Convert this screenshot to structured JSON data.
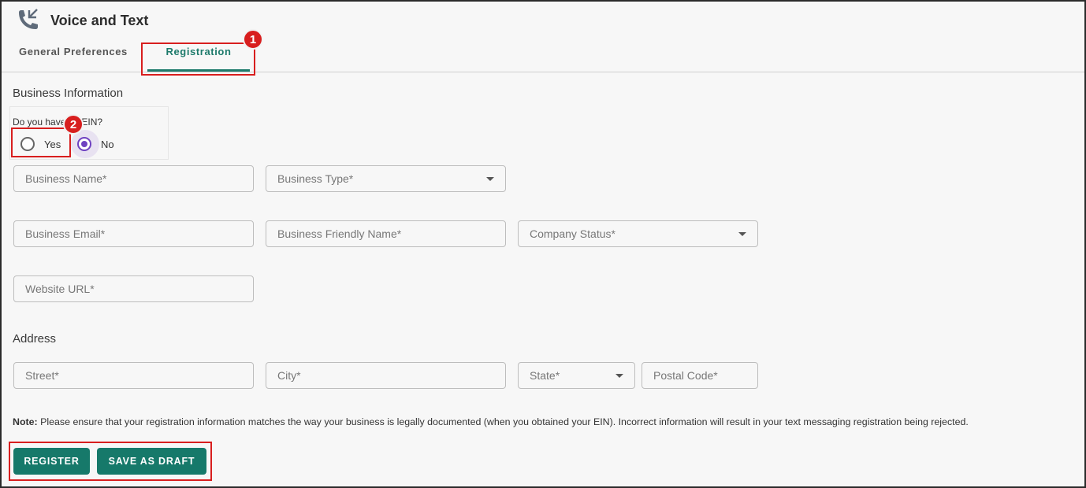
{
  "app": {
    "title": "Voice and Text",
    "icon": "phone-icon"
  },
  "tabs": [
    {
      "label": "General Preferences",
      "active": false
    },
    {
      "label": "Registration",
      "active": true
    }
  ],
  "business_info": {
    "section_title": "Business Information",
    "question": "Do you have an EIN?",
    "options": [
      {
        "label": "Yes",
        "selected": false
      },
      {
        "label": "No",
        "selected": true
      }
    ],
    "fields": {
      "business_name": "Business Name*",
      "business_type": "Business Type*",
      "business_email": "Business Email*",
      "business_friendly_name": "Business Friendly Name*",
      "company_status": "Company Status*",
      "website_url": "Website URL*"
    }
  },
  "address": {
    "section_title": "Address",
    "fields": {
      "street": "Street*",
      "city": "City*",
      "state": "State*",
      "postal_code": "Postal Code*"
    }
  },
  "note": {
    "prefix": "Note:",
    "text": " Please ensure that your registration information matches the way your business is legally documented (when you obtained your EIN). Incorrect information will result in your text messaging registration being rejected."
  },
  "actions": {
    "register": "REGISTER",
    "save_draft": "SAVE AS DRAFT"
  },
  "annotations": {
    "step1": "1",
    "step2": "2"
  },
  "colors": {
    "accent": "#16796a",
    "radio_selected": "#6f42c1",
    "annotation": "#d81e1e"
  }
}
